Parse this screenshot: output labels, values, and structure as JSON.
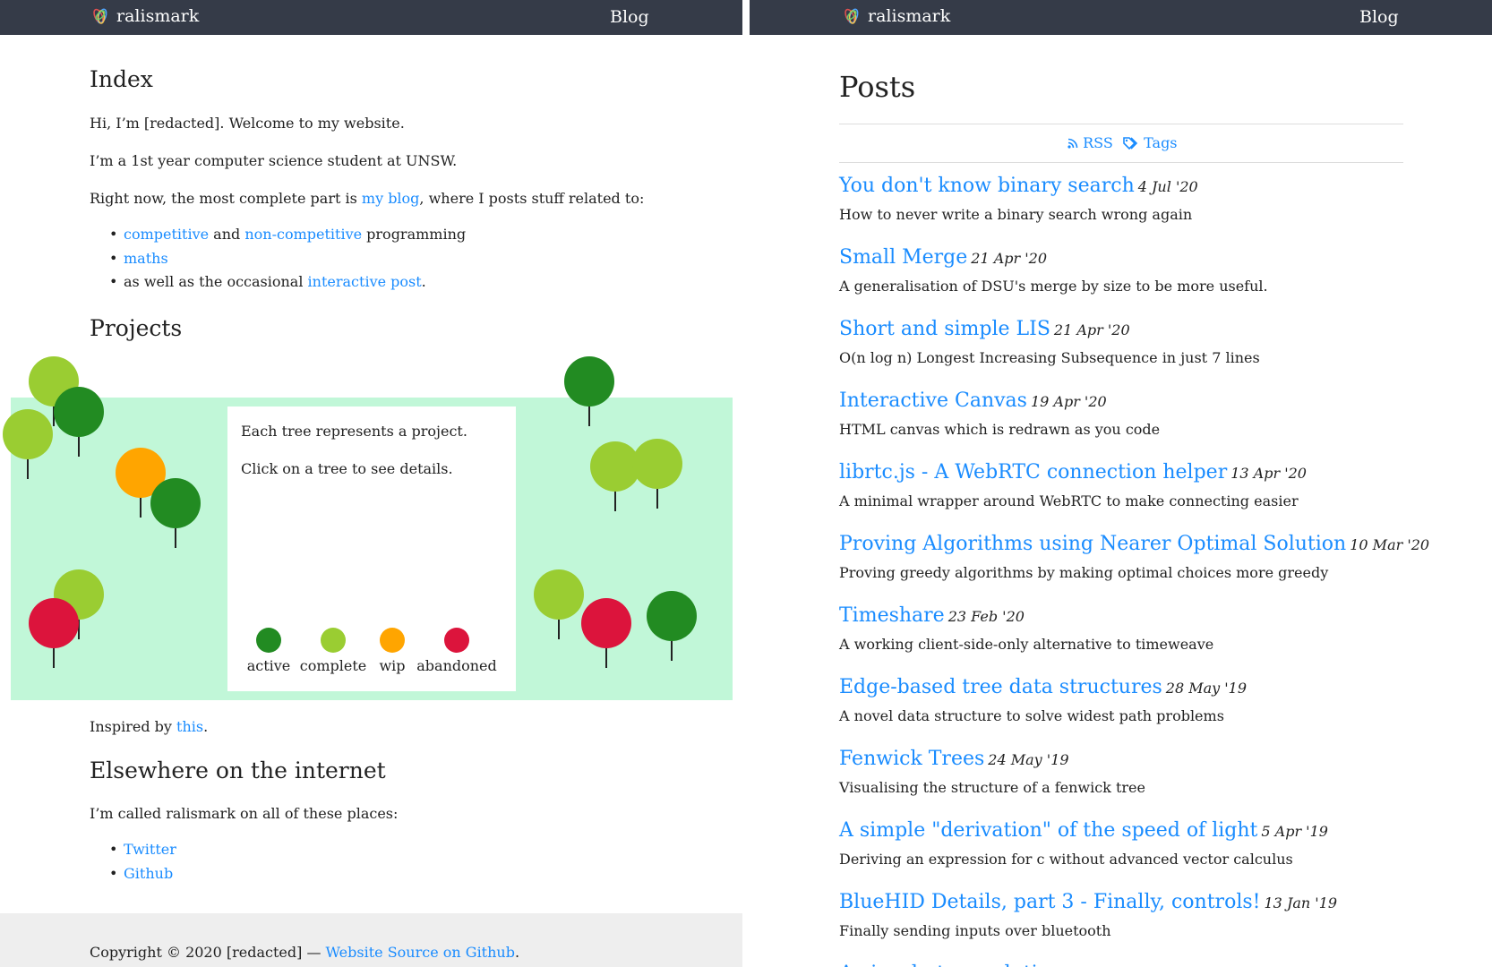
{
  "left": {
    "navbar": {
      "brand": "ralismark",
      "blog_link": "Blog"
    },
    "index_heading": "Index",
    "intro": {
      "line1": "Hi, I’m [redacted]. Welcome to my website.",
      "line2": "I’m a 1st year computer science student at UNSW.",
      "line3_prefix": "Right now, the most complete part is ",
      "line3_link": "my blog",
      "line3_suffix": ", where I posts stuff related to:"
    },
    "topics": {
      "item1_link1": "competitive",
      "item1_and": " and ",
      "item1_link2": "non-competitive",
      "item1_suffix": " programming",
      "item2_link": "maths",
      "item3_prefix": "as well as the occasional ",
      "item3_link": "interactive post",
      "item3_suffix": "."
    },
    "projects_heading": "Projects",
    "forest": {
      "info_line1": "Each tree represents a project.",
      "info_line2": "Click on a tree to see details.",
      "legend": [
        {
          "label": "active",
          "color": "#228b22"
        },
        {
          "label": "complete",
          "color": "#9acd32"
        },
        {
          "label": "wip",
          "color": "#ffa500"
        },
        {
          "label": "abandoned",
          "color": "#dc143c"
        }
      ],
      "trees": [
        {
          "status": "complete",
          "color": "#9acd32"
        },
        {
          "status": "active",
          "color": "#228b22"
        },
        {
          "status": "complete",
          "color": "#9acd32"
        },
        {
          "status": "wip",
          "color": "#ffa500"
        },
        {
          "status": "active",
          "color": "#228b22"
        },
        {
          "status": "complete",
          "color": "#9acd32"
        },
        {
          "status": "abandoned",
          "color": "#dc143c"
        },
        {
          "status": "active",
          "color": "#228b22"
        },
        {
          "status": "complete",
          "color": "#9acd32"
        },
        {
          "status": "complete",
          "color": "#9acd32"
        },
        {
          "status": "complete",
          "color": "#9acd32"
        },
        {
          "status": "abandoned",
          "color": "#dc143c"
        },
        {
          "status": "active",
          "color": "#228b22"
        }
      ]
    },
    "inspired": {
      "prefix": "Inspired by ",
      "link": "this",
      "suffix": "."
    },
    "elsewhere_heading": "Elsewhere on the internet",
    "elsewhere_text": "I’m called ralismark on all of these places:",
    "social": [
      "Twitter",
      "Github"
    ],
    "footer": {
      "copyright": "Copyright © 2020 [redacted] — ",
      "source_link": "Website Source on Github",
      "suffix": "."
    }
  },
  "right": {
    "navbar": {
      "brand": "ralismark",
      "blog_link": "Blog"
    },
    "posts_heading": "Posts",
    "rss_label": "RSS",
    "tags_label": "Tags",
    "posts": [
      {
        "title": "You don't know binary search",
        "date": "4 Jul '20",
        "desc": "How to never write a binary search wrong again"
      },
      {
        "title": "Small Merge",
        "date": "21 Apr '20",
        "desc": "A generalisation of DSU's merge by size to be more useful."
      },
      {
        "title": "Short and simple LIS",
        "date": "21 Apr '20",
        "desc": "O(n log n) Longest Increasing Subsequence in just 7 lines"
      },
      {
        "title": "Interactive Canvas",
        "date": "19 Apr '20",
        "desc": "HTML canvas which is redrawn as you code"
      },
      {
        "title": "librtc.js - A WebRTC connection helper",
        "date": "13 Apr '20",
        "desc": "A minimal wrapper around WebRTC to make connecting easier"
      },
      {
        "title": "Proving Algorithms using Nearer Optimal Solution",
        "date": "10 Mar '20",
        "desc": "Proving greedy algorithms by making optimal choices more greedy"
      },
      {
        "title": "Timeshare",
        "date": "23 Feb '20",
        "desc": "A working client-side-only alternative to timeweave"
      },
      {
        "title": "Edge-based tree data structures",
        "date": "28 May '19",
        "desc": "A novel data structure to solve widest path problems"
      },
      {
        "title": "Fenwick Trees",
        "date": "24 May '19",
        "desc": "Visualising the structure of a fenwick tree"
      },
      {
        "title": "A simple \"derivation\" of the speed of light",
        "date": "5 Apr '19",
        "desc": "Deriving an expression for c without advanced vector calculus"
      },
      {
        "title": "BlueHID Details, part 3 - Finally, controls!",
        "date": "13 Jan '19",
        "desc": "Finally sending inputs over bluetooth"
      },
      {
        "title": "A visual nt... evolution",
        "date": "",
        "desc": ""
      }
    ]
  }
}
